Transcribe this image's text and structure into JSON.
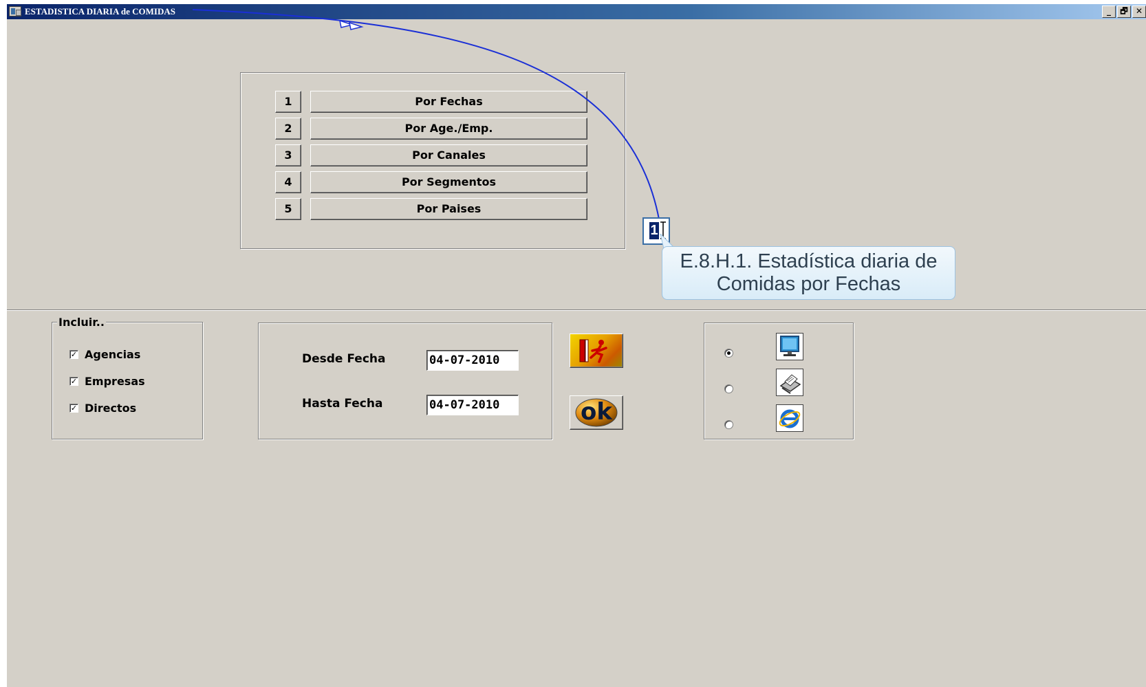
{
  "window": {
    "title": "ESTADISTICA DIARIA de COMIDAS",
    "controls": {
      "minimize": "_",
      "restore": "🗗",
      "close": "✕"
    }
  },
  "menu_options": [
    {
      "number": "1",
      "label": "Por Fechas"
    },
    {
      "number": "2",
      "label": "Por Age./Emp."
    },
    {
      "number": "3",
      "label": "Por Canales"
    },
    {
      "number": "4",
      "label": "Por Segmentos"
    },
    {
      "number": "5",
      "label": "Por Paises"
    }
  ],
  "include_group": {
    "legend": "Incluir..",
    "items": [
      {
        "label": "Agencias",
        "checked": true,
        "mark": "✓"
      },
      {
        "label": "Empresas",
        "checked": true,
        "mark": "✓"
      },
      {
        "label": "Directos",
        "checked": true,
        "mark": "✓"
      }
    ]
  },
  "dates": {
    "from_label": "Desde  Fecha",
    "from_value": "04-07-2010",
    "to_label": "Hasta  Fecha",
    "to_value": "04-07-2010"
  },
  "actions": {
    "exit_icon": "exit-icon",
    "ok_label": "ok"
  },
  "output": {
    "options": [
      {
        "icon": "monitor-icon",
        "selected": true
      },
      {
        "icon": "printer-icon",
        "selected": false
      },
      {
        "icon": "browser-icon",
        "selected": false
      }
    ]
  },
  "annotation": {
    "marker": "1",
    "callout_line1": "E.8.H.1.    Estadística diaria de",
    "callout_line2": "Comidas por Fechas",
    "line_color": "#1a2fd6"
  }
}
